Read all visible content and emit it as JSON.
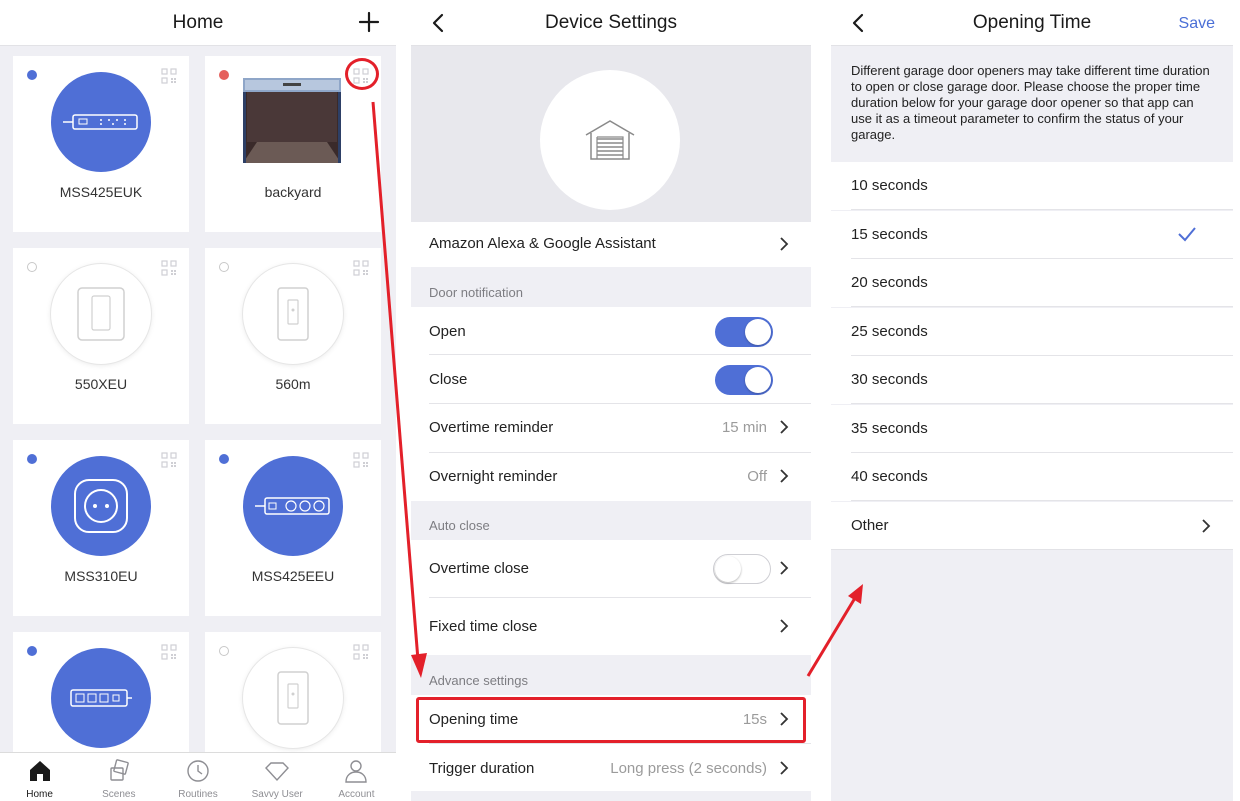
{
  "home": {
    "title": "Home",
    "devices": [
      {
        "name": "MSS425EUK",
        "status": "blue",
        "style": "filled",
        "icon": "power-strip-icon"
      },
      {
        "name": "backyard",
        "status": "red",
        "style": "image",
        "icon": "garage-photo"
      },
      {
        "name": "550XEU",
        "status": "empty",
        "style": "outline",
        "icon": "wall-switch-icon"
      },
      {
        "name": "560m",
        "status": "empty",
        "style": "outline",
        "icon": "dimmer-switch-icon"
      },
      {
        "name": "MSS310EU",
        "status": "blue",
        "style": "filled",
        "icon": "smart-plug-icon"
      },
      {
        "name": "MSS425EEU",
        "status": "blue",
        "style": "filled",
        "icon": "power-strip-round-icon"
      },
      {
        "name": "",
        "status": "blue",
        "style": "filled",
        "icon": "power-strip-icon"
      },
      {
        "name": "",
        "status": "empty",
        "style": "outline",
        "icon": "dimmer-switch-icon"
      }
    ],
    "tabs": [
      {
        "label": "Home",
        "icon": "home-icon",
        "active": true
      },
      {
        "label": "Scenes",
        "icon": "scenes-icon",
        "active": false
      },
      {
        "label": "Routines",
        "icon": "clock-icon",
        "active": false
      },
      {
        "label": "Savvy User",
        "icon": "diamond-icon",
        "active": false
      },
      {
        "label": "Account",
        "icon": "person-icon",
        "active": false
      }
    ]
  },
  "settings": {
    "title": "Device Settings",
    "alexa_label": "Amazon Alexa & Google Assistant",
    "door_notification": {
      "header": "Door notification",
      "open_label": "Open",
      "open_on": true,
      "close_label": "Close",
      "close_on": true,
      "overtime_label": "Overtime reminder",
      "overtime_value": "15 min",
      "overnight_label": "Overnight reminder",
      "overnight_value": "Off"
    },
    "auto_close": {
      "header": "Auto close",
      "overtime_close_label": "Overtime close",
      "overtime_close_on": false,
      "fixed_time_label": "Fixed time close"
    },
    "advance": {
      "header": "Advance settings",
      "opening_time_label": "Opening time",
      "opening_time_value": "15s",
      "trigger_label": "Trigger duration",
      "trigger_value": "Long press (2 seconds)"
    }
  },
  "opening_time": {
    "title": "Opening Time",
    "save_label": "Save",
    "description": "Different garage door openers may take different time duration to open or close garage door. Please choose the proper time duration below for your garage door opener so that app can use it as a timeout parameter to confirm the status of your garage.",
    "options": [
      "10 seconds",
      "15 seconds",
      "20 seconds",
      "25 seconds",
      "30 seconds",
      "35 seconds",
      "40 seconds"
    ],
    "selected": "15 seconds",
    "other_label": "Other"
  },
  "colors": {
    "accent": "#4f6fd6",
    "highlight": "#e3202a",
    "background": "#efeff4"
  }
}
